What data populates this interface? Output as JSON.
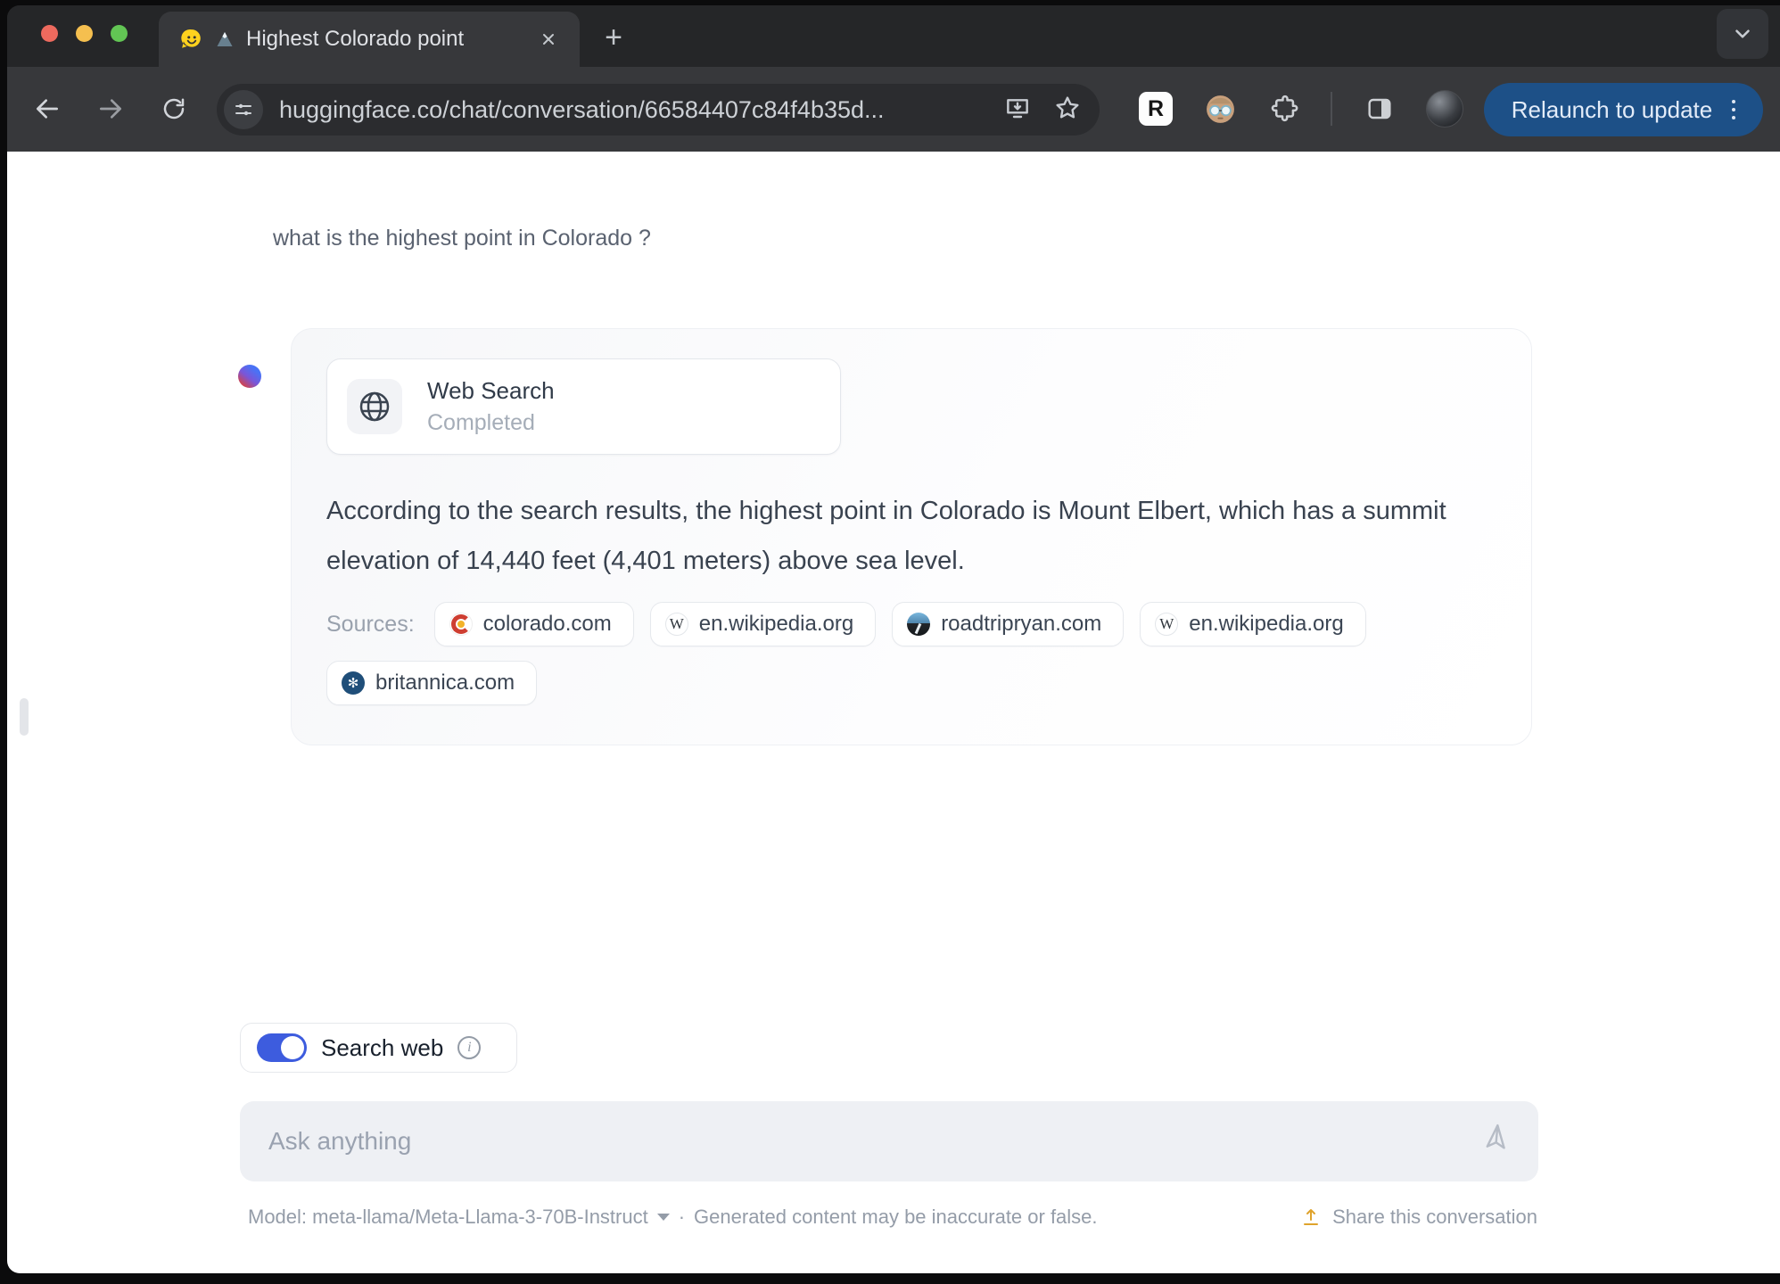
{
  "browser": {
    "tab_title": "Highest Colorado point",
    "url": "huggingface.co/chat/conversation/66584407c84f4b35d...",
    "relaunch_button": "Relaunch to update"
  },
  "icons": {
    "new_tab_glyph": "+",
    "r_extension_glyph": "R",
    "wikipedia_glyph": "W",
    "britannica_glyph": "✻",
    "info_glyph": "i"
  },
  "chat": {
    "user_question": "what is the highest point in Colorado ?",
    "web_search": {
      "title": "Web Search",
      "status": "Completed"
    },
    "answer": "According to the search results, the highest point in Colorado is Mount Elbert, which has a summit elevation of 14,440 feet (4,401 meters) above sea level.",
    "sources_label": "Sources:",
    "sources": [
      {
        "domain": "colorado.com"
      },
      {
        "domain": "en.wikipedia.org"
      },
      {
        "domain": "roadtripryan.com"
      },
      {
        "domain": "en.wikipedia.org"
      },
      {
        "domain": "britannica.com"
      }
    ],
    "search_web_label": "Search web",
    "input_placeholder": "Ask anything",
    "footer": {
      "model_label": "Model: meta-llama/Meta-Llama-3-70B-Instruct",
      "separator": "·",
      "disclaimer": "Generated content may be inaccurate or false.",
      "share_label": "Share this conversation"
    }
  },
  "colors": {
    "relaunch_blue": "#1d5087",
    "toggle_blue": "#3d5cde",
    "share_gold": "#dfa32c",
    "hugging_yellow": "#ffd21e",
    "traffic_red": "#ed6a5e",
    "traffic_yellow": "#f5bf4f",
    "traffic_green": "#62c554"
  }
}
